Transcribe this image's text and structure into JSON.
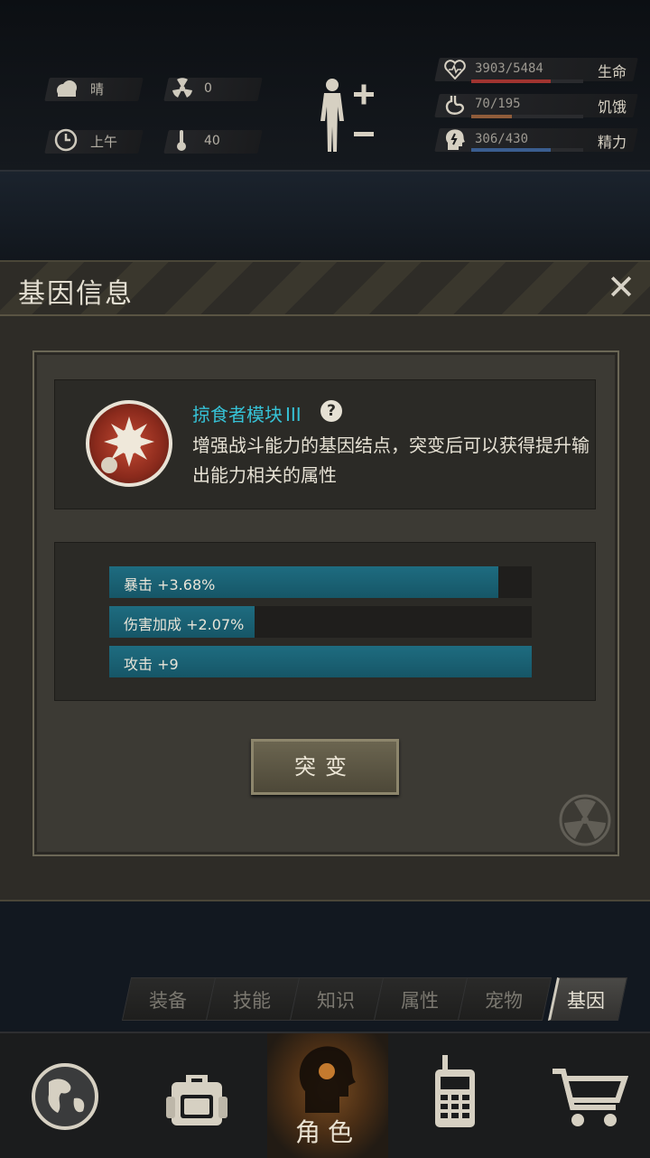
{
  "hud": {
    "weather": "晴",
    "radiation": "0",
    "time_of_day": "上午",
    "temperature": "40",
    "health": {
      "label": "生命",
      "value": "3903/5484",
      "fraction": 0.712,
      "color": "#a03430"
    },
    "hunger": {
      "label": "饥饿",
      "value": "70/195",
      "fraction": 0.359,
      "color": "#8f5c3a"
    },
    "energy": {
      "label": "精力",
      "value": "306/430",
      "fraction": 0.712,
      "color": "#3a5d8f"
    }
  },
  "modal": {
    "title": "基因信息",
    "close_icon": "close-icon",
    "gene": {
      "name": "掠食者模块",
      "level": "III",
      "help": "?",
      "description": "增强战斗能力的基因结点，突变后可以获得提升输出能力相关的属性"
    },
    "stats": [
      {
        "text": "暴击 +3.68%",
        "fraction": 0.92
      },
      {
        "text": "伤害加成 +2.07%",
        "fraction": 0.345
      },
      {
        "text": "攻击 +9",
        "fraction": 1.0
      }
    ],
    "mutate_button": "突变"
  },
  "tabs": [
    {
      "label": "装备",
      "active": false
    },
    {
      "label": "技能",
      "active": false
    },
    {
      "label": "知识",
      "active": false
    },
    {
      "label": "属性",
      "active": false
    },
    {
      "label": "宠物",
      "active": false
    },
    {
      "label": "基因",
      "active": true
    }
  ],
  "bottom_nav": {
    "items": [
      {
        "icon": "globe-icon",
        "label": ""
      },
      {
        "icon": "backpack-icon",
        "label": ""
      },
      {
        "icon": "character-head-icon",
        "label": "角色",
        "active": true
      },
      {
        "icon": "walkie-talkie-icon",
        "label": ""
      },
      {
        "icon": "shopping-cart-icon",
        "label": ""
      }
    ]
  }
}
